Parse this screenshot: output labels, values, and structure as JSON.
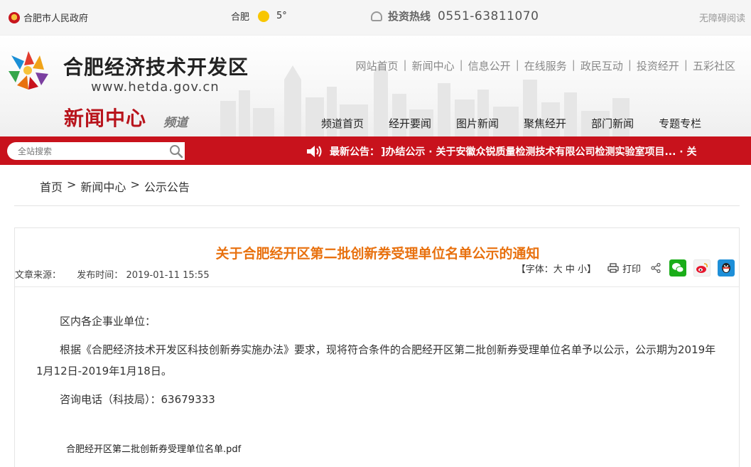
{
  "topbar": {
    "gov_name": "合肥市人民政府",
    "city": "合肥",
    "temperature": "5°",
    "hotline_label": "投资热线",
    "hotline_number": "0551-63811070",
    "accessibility": "无障碍阅读"
  },
  "header": {
    "site_title": "合肥经济技术开发区",
    "site_url": "www.hetda.gov.cn",
    "channel_name": "新闻中心",
    "channel_sub": "频道",
    "top_nav": [
      "网站首页",
      "新闻中心",
      "信息公开",
      "在线服务",
      "政民互动",
      "投资经开",
      "五彩社区"
    ],
    "main_nav": [
      "频道首页",
      "经开要闻",
      "图片新闻",
      "聚焦经开",
      "部门新闻",
      "专题专栏"
    ]
  },
  "search": {
    "placeholder": "全站搜索"
  },
  "notice": {
    "label": "最新公告：",
    "text": "]办结公示 · 关于安徽众锐质量检测技术有限公司检测实验室项目... · 关"
  },
  "breadcrumb": [
    "首页",
    "新闻中心",
    "公示公告"
  ],
  "article": {
    "title": "关于合肥经开区第二批创新券受理单位名单公示的通知",
    "source_label": "文章来源：",
    "time_label": "发布时间：",
    "time": "2019-01-11 15:55",
    "font_size": "【字体：大 中 小】",
    "print": "打印",
    "paragraphs": [
      "区内各企事业单位：",
      "根据《合肥经济技术开发区科技创新券实施办法》要求，现将符合条件的合肥经开区第二批创新券受理单位名单予以公示，公示期为2019年1月12日-2019年1月18日。",
      "咨询电话（科技局）：63679333"
    ],
    "attachment": "合肥经开区第二批创新券受理单位名单.pdf"
  },
  "colors": {
    "brand_red": "#c8121c",
    "title_orange": "#e8710f",
    "wechat": "#1aad19",
    "qq": "#1e8fd8"
  },
  "icons": [
    "emblem-icon",
    "sun-icon",
    "phone-icon",
    "logo-icon",
    "search-icon",
    "speaker-icon",
    "print-icon",
    "share-icon",
    "wechat-icon",
    "weibo-icon",
    "qq-icon"
  ]
}
